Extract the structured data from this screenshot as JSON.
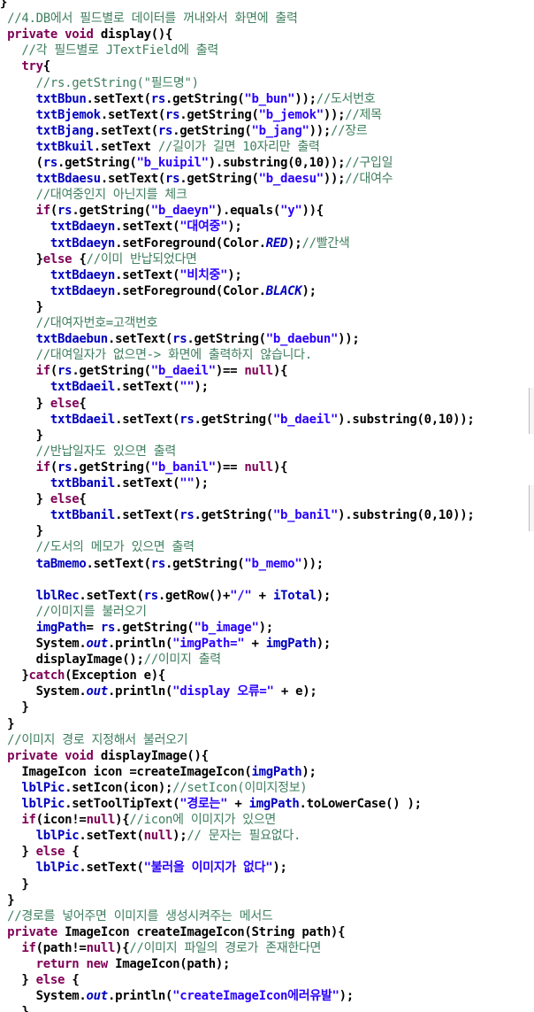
{
  "colors": {
    "keyword": "#7f0055",
    "field": "#0000c0",
    "string": "#2a00ff",
    "comment": "#3f7f5f",
    "plain": "#000000"
  },
  "lines": [
    [
      {
        "c": "t-plain",
        "t": "}"
      }
    ],
    [
      {
        "c": "t-com",
        "t": " //4.DB에서 필드별로 데이터를 꺼내와서 화면에 출력"
      }
    ],
    [
      {
        "c": "t-kw",
        "t": " private void "
      },
      {
        "c": "t-plain",
        "t": "display(){"
      }
    ],
    [
      {
        "c": "t-com",
        "t": "   //각 필드별로 JTextField에 출력"
      }
    ],
    [
      {
        "c": "t-kw",
        "t": "   try"
      },
      {
        "c": "t-plain",
        "t": "{"
      }
    ],
    [
      {
        "c": "t-com",
        "t": "     //rs.getString(\"필드명\")"
      }
    ],
    [
      {
        "c": "t-field",
        "t": "     txtBbun"
      },
      {
        "c": "t-plain",
        "t": ".setText("
      },
      {
        "c": "t-field",
        "t": "rs"
      },
      {
        "c": "t-plain",
        "t": ".getString("
      },
      {
        "c": "t-str",
        "t": "\"b_bun\""
      },
      {
        "c": "t-plain",
        "t": "));"
      },
      {
        "c": "t-com",
        "t": "//도서번호"
      }
    ],
    [
      {
        "c": "t-field",
        "t": "     txtBjemok"
      },
      {
        "c": "t-plain",
        "t": ".setText("
      },
      {
        "c": "t-field",
        "t": "rs"
      },
      {
        "c": "t-plain",
        "t": ".getString("
      },
      {
        "c": "t-str",
        "t": "\"b_jemok\""
      },
      {
        "c": "t-plain",
        "t": "));"
      },
      {
        "c": "t-com",
        "t": "//제목"
      }
    ],
    [
      {
        "c": "t-field",
        "t": "     txtBjang"
      },
      {
        "c": "t-plain",
        "t": ".setText("
      },
      {
        "c": "t-field",
        "t": "rs"
      },
      {
        "c": "t-plain",
        "t": ".getString("
      },
      {
        "c": "t-str",
        "t": "\"b_jang\""
      },
      {
        "c": "t-plain",
        "t": "));"
      },
      {
        "c": "t-com",
        "t": "//장르"
      }
    ],
    [
      {
        "c": "t-field",
        "t": "     txtBkuil"
      },
      {
        "c": "t-plain",
        "t": ".setText "
      },
      {
        "c": "t-com",
        "t": "//길이가 길면 10자리만 출력"
      }
    ],
    [
      {
        "c": "t-plain",
        "t": "     ("
      },
      {
        "c": "t-field",
        "t": "rs"
      },
      {
        "c": "t-plain",
        "t": ".getString("
      },
      {
        "c": "t-str",
        "t": "\"b_kuipil\""
      },
      {
        "c": "t-plain",
        "t": ").substring(0,10));"
      },
      {
        "c": "t-com",
        "t": "//구입일"
      }
    ],
    [
      {
        "c": "t-field",
        "t": "     txtBdaesu"
      },
      {
        "c": "t-plain",
        "t": ".setText("
      },
      {
        "c": "t-field",
        "t": "rs"
      },
      {
        "c": "t-plain",
        "t": ".getString("
      },
      {
        "c": "t-str",
        "t": "\"b_daesu\""
      },
      {
        "c": "t-plain",
        "t": "));"
      },
      {
        "c": "t-com",
        "t": "//대여수"
      }
    ],
    [
      {
        "c": "t-com",
        "t": "     //대여중인지 아닌지를 체크"
      }
    ],
    [
      {
        "c": "t-kw",
        "t": "     if"
      },
      {
        "c": "t-plain",
        "t": "("
      },
      {
        "c": "t-field",
        "t": "rs"
      },
      {
        "c": "t-plain",
        "t": ".getString("
      },
      {
        "c": "t-str",
        "t": "\"b_daeyn\""
      },
      {
        "c": "t-plain",
        "t": ").equals("
      },
      {
        "c": "t-str",
        "t": "\"y\""
      },
      {
        "c": "t-plain",
        "t": ")){"
      }
    ],
    [
      {
        "c": "t-field",
        "t": "       txtBdaeyn"
      },
      {
        "c": "t-plain",
        "t": ".setText("
      },
      {
        "c": "t-str",
        "t": "\"대여중\""
      },
      {
        "c": "t-plain",
        "t": ");"
      }
    ],
    [
      {
        "c": "t-field",
        "t": "       txtBdaeyn"
      },
      {
        "c": "t-plain",
        "t": ".setForeground(Color."
      },
      {
        "c": "t-static",
        "t": "RED"
      },
      {
        "c": "t-plain",
        "t": ");"
      },
      {
        "c": "t-com",
        "t": "//빨간색"
      }
    ],
    [
      {
        "c": "t-plain",
        "t": "     }"
      },
      {
        "c": "t-kw",
        "t": "else "
      },
      {
        "c": "t-plain",
        "t": "{"
      },
      {
        "c": "t-com",
        "t": "//이미 반납되었다면"
      }
    ],
    [
      {
        "c": "t-field",
        "t": "       txtBdaeyn"
      },
      {
        "c": "t-plain",
        "t": ".setText("
      },
      {
        "c": "t-str",
        "t": "\"비치중\""
      },
      {
        "c": "t-plain",
        "t": ");"
      }
    ],
    [
      {
        "c": "t-field",
        "t": "       txtBdaeyn"
      },
      {
        "c": "t-plain",
        "t": ".setForeground(Color."
      },
      {
        "c": "t-static",
        "t": "BLACK"
      },
      {
        "c": "t-plain",
        "t": ");"
      }
    ],
    [
      {
        "c": "t-plain",
        "t": "     }"
      }
    ],
    [
      {
        "c": "t-com",
        "t": "     //대여자번호=고객번호"
      }
    ],
    [
      {
        "c": "t-field",
        "t": "     txtBdaebun"
      },
      {
        "c": "t-plain",
        "t": ".setText("
      },
      {
        "c": "t-field",
        "t": "rs"
      },
      {
        "c": "t-plain",
        "t": ".getString("
      },
      {
        "c": "t-str",
        "t": "\"b_daebun\""
      },
      {
        "c": "t-plain",
        "t": "));"
      }
    ],
    [
      {
        "c": "t-com",
        "t": "     //대여일자가 없으면-> 화면에 출력하지 않습니다."
      }
    ],
    [
      {
        "c": "t-kw",
        "t": "     if"
      },
      {
        "c": "t-plain",
        "t": "("
      },
      {
        "c": "t-field",
        "t": "rs"
      },
      {
        "c": "t-plain",
        "t": ".getString("
      },
      {
        "c": "t-str",
        "t": "\"b_daeil\""
      },
      {
        "c": "t-plain",
        "t": ")== "
      },
      {
        "c": "t-kw",
        "t": "null"
      },
      {
        "c": "t-plain",
        "t": "){"
      }
    ],
    [
      {
        "c": "t-field",
        "t": "       txtBdaeil"
      },
      {
        "c": "t-plain",
        "t": ".setText("
      },
      {
        "c": "t-str",
        "t": "\"\""
      },
      {
        "c": "t-plain",
        "t": ");"
      }
    ],
    [
      {
        "c": "t-plain",
        "t": "     } "
      },
      {
        "c": "t-kw",
        "t": "else"
      },
      {
        "c": "t-plain",
        "t": "{"
      }
    ],
    [
      {
        "c": "t-field",
        "t": "       txtBdaeil"
      },
      {
        "c": "t-plain",
        "t": ".setText("
      },
      {
        "c": "t-field",
        "t": "rs"
      },
      {
        "c": "t-plain",
        "t": ".getString("
      },
      {
        "c": "t-str",
        "t": "\"b_daeil\""
      },
      {
        "c": "t-plain",
        "t": ").substring(0,10));"
      }
    ],
    [
      {
        "c": "t-plain",
        "t": "     }"
      }
    ],
    [
      {
        "c": "t-com",
        "t": "     //반납일자도 있으면 출력"
      }
    ],
    [
      {
        "c": "t-kw",
        "t": "     if"
      },
      {
        "c": "t-plain",
        "t": "("
      },
      {
        "c": "t-field",
        "t": "rs"
      },
      {
        "c": "t-plain",
        "t": ".getString("
      },
      {
        "c": "t-str",
        "t": "\"b_banil\""
      },
      {
        "c": "t-plain",
        "t": ")== "
      },
      {
        "c": "t-kw",
        "t": "null"
      },
      {
        "c": "t-plain",
        "t": "){"
      }
    ],
    [
      {
        "c": "t-field",
        "t": "       txtBbanil"
      },
      {
        "c": "t-plain",
        "t": ".setText("
      },
      {
        "c": "t-str",
        "t": "\"\""
      },
      {
        "c": "t-plain",
        "t": ");"
      }
    ],
    [
      {
        "c": "t-plain",
        "t": "     } "
      },
      {
        "c": "t-kw",
        "t": "else"
      },
      {
        "c": "t-plain",
        "t": "{"
      }
    ],
    [
      {
        "c": "t-field",
        "t": "       txtBbanil"
      },
      {
        "c": "t-plain",
        "t": ".setText("
      },
      {
        "c": "t-field",
        "t": "rs"
      },
      {
        "c": "t-plain",
        "t": ".getString("
      },
      {
        "c": "t-str",
        "t": "\"b_banil\""
      },
      {
        "c": "t-plain",
        "t": ").substring(0,10));"
      }
    ],
    [
      {
        "c": "t-plain",
        "t": "     }"
      }
    ],
    [
      {
        "c": "t-com",
        "t": "     //도서의 메모가 있으면 출력"
      }
    ],
    [
      {
        "c": "t-field",
        "t": "     taBmemo"
      },
      {
        "c": "t-plain",
        "t": ".setText("
      },
      {
        "c": "t-field",
        "t": "rs"
      },
      {
        "c": "t-plain",
        "t": ".getString("
      },
      {
        "c": "t-str",
        "t": "\"b_memo\""
      },
      {
        "c": "t-plain",
        "t": "));"
      }
    ],
    [
      {
        "c": "t-plain",
        "t": ""
      }
    ],
    [
      {
        "c": "t-field",
        "t": "     lblRec"
      },
      {
        "c": "t-plain",
        "t": ".setText("
      },
      {
        "c": "t-field",
        "t": "rs"
      },
      {
        "c": "t-plain",
        "t": ".getRow()+"
      },
      {
        "c": "t-str",
        "t": "\"/\""
      },
      {
        "c": "t-plain",
        "t": " + "
      },
      {
        "c": "t-field",
        "t": "iTotal"
      },
      {
        "c": "t-plain",
        "t": ");"
      }
    ],
    [
      {
        "c": "t-com",
        "t": "     //이미지를 불러오기"
      }
    ],
    [
      {
        "c": "t-field",
        "t": "     imgPath"
      },
      {
        "c": "t-plain",
        "t": "= "
      },
      {
        "c": "t-field",
        "t": "rs"
      },
      {
        "c": "t-plain",
        "t": ".getString("
      },
      {
        "c": "t-str",
        "t": "\"b_image\""
      },
      {
        "c": "t-plain",
        "t": ");"
      }
    ],
    [
      {
        "c": "t-plain",
        "t": "     System."
      },
      {
        "c": "t-static",
        "t": "out"
      },
      {
        "c": "t-plain",
        "t": ".println("
      },
      {
        "c": "t-str",
        "t": "\"imgPath=\""
      },
      {
        "c": "t-plain",
        "t": " + "
      },
      {
        "c": "t-field",
        "t": "imgPath"
      },
      {
        "c": "t-plain",
        "t": ");"
      }
    ],
    [
      {
        "c": "t-plain",
        "t": "     displayImage();"
      },
      {
        "c": "t-com",
        "t": "//이미지 출력"
      }
    ],
    [
      {
        "c": "t-plain",
        "t": "   }"
      },
      {
        "c": "t-kw",
        "t": "catch"
      },
      {
        "c": "t-plain",
        "t": "(Exception e){"
      }
    ],
    [
      {
        "c": "t-plain",
        "t": "     System."
      },
      {
        "c": "t-static",
        "t": "out"
      },
      {
        "c": "t-plain",
        "t": ".println("
      },
      {
        "c": "t-str",
        "t": "\"display 오류=\""
      },
      {
        "c": "t-plain",
        "t": " + e);"
      }
    ],
    [
      {
        "c": "t-plain",
        "t": "   }"
      }
    ],
    [
      {
        "c": "t-plain",
        "t": " }"
      }
    ],
    [
      {
        "c": "t-com",
        "t": " //이미지 경로 지정해서 불러오기"
      }
    ],
    [
      {
        "c": "t-kw",
        "t": " private void "
      },
      {
        "c": "t-plain",
        "t": "displayImage(){"
      }
    ],
    [
      {
        "c": "t-plain",
        "t": "   ImageIcon icon =createImageIcon("
      },
      {
        "c": "t-field",
        "t": "imgPath"
      },
      {
        "c": "t-plain",
        "t": ");"
      }
    ],
    [
      {
        "c": "t-field",
        "t": "   lblPic"
      },
      {
        "c": "t-plain",
        "t": ".setIcon(icon);"
      },
      {
        "c": "t-com",
        "t": "//setIcon(이미지정보)"
      }
    ],
    [
      {
        "c": "t-field",
        "t": "   lblPic"
      },
      {
        "c": "t-plain",
        "t": ".setToolTipText("
      },
      {
        "c": "t-str",
        "t": "\"경로는\""
      },
      {
        "c": "t-plain",
        "t": " + "
      },
      {
        "c": "t-field",
        "t": "imgPath"
      },
      {
        "c": "t-plain",
        "t": ".toLowerCase() );"
      }
    ],
    [
      {
        "c": "t-kw",
        "t": "   if"
      },
      {
        "c": "t-plain",
        "t": "(icon!="
      },
      {
        "c": "t-kw",
        "t": "null"
      },
      {
        "c": "t-plain",
        "t": "){"
      },
      {
        "c": "t-com",
        "t": "//icon에 이미지가 있으면"
      }
    ],
    [
      {
        "c": "t-field",
        "t": "     lblPic"
      },
      {
        "c": "t-plain",
        "t": ".setText("
      },
      {
        "c": "t-kw",
        "t": "null"
      },
      {
        "c": "t-plain",
        "t": ");"
      },
      {
        "c": "t-com",
        "t": "// 문자는 필요없다."
      }
    ],
    [
      {
        "c": "t-plain",
        "t": "   } "
      },
      {
        "c": "t-kw",
        "t": "else "
      },
      {
        "c": "t-plain",
        "t": "{"
      }
    ],
    [
      {
        "c": "t-field",
        "t": "     lblPic"
      },
      {
        "c": "t-plain",
        "t": ".setText("
      },
      {
        "c": "t-str",
        "t": "\"불러올 이미지가 없다\""
      },
      {
        "c": "t-plain",
        "t": ");"
      }
    ],
    [
      {
        "c": "t-plain",
        "t": "   }"
      }
    ],
    [
      {
        "c": "t-plain",
        "t": " }"
      }
    ],
    [
      {
        "c": "t-com",
        "t": " //경로를 넣어주면 이미지를 생성시켜주는 메서드"
      }
    ],
    [
      {
        "c": "t-kw",
        "t": " private "
      },
      {
        "c": "t-plain",
        "t": "ImageIcon createImageIcon(String path){"
      }
    ],
    [
      {
        "c": "t-kw",
        "t": "   if"
      },
      {
        "c": "t-plain",
        "t": "(path!="
      },
      {
        "c": "t-kw",
        "t": "null"
      },
      {
        "c": "t-plain",
        "t": "){"
      },
      {
        "c": "t-com",
        "t": "//이미지 파일의 경로가 존재한다면"
      }
    ],
    [
      {
        "c": "t-kw",
        "t": "     return new "
      },
      {
        "c": "t-plain",
        "t": "ImageIcon(path);"
      }
    ],
    [
      {
        "c": "t-plain",
        "t": "   } "
      },
      {
        "c": "t-kw",
        "t": "else "
      },
      {
        "c": "t-plain",
        "t": "{"
      }
    ],
    [
      {
        "c": "t-plain",
        "t": "     System."
      },
      {
        "c": "t-static",
        "t": "out"
      },
      {
        "c": "t-plain",
        "t": ".println("
      },
      {
        "c": "t-str",
        "t": "\"createImageIcon에러유발\""
      },
      {
        "c": "t-plain",
        "t": ");"
      }
    ],
    [
      {
        "c": "t-plain",
        "t": "   }"
      }
    ]
  ]
}
